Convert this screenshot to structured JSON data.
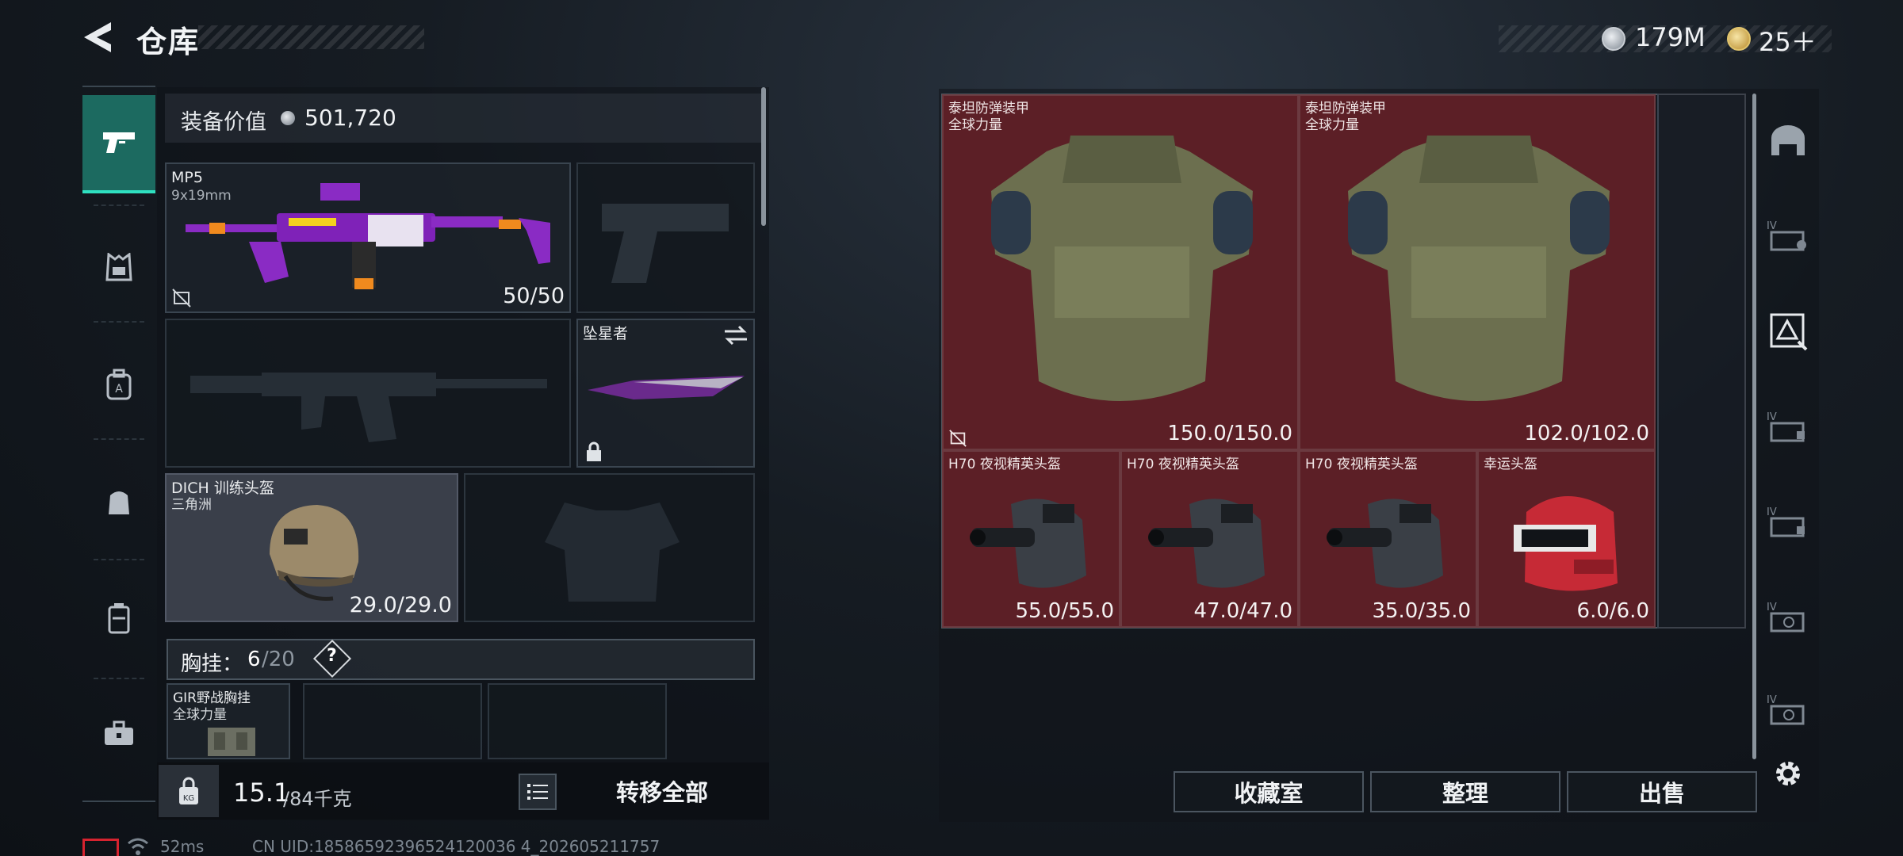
{
  "header": {
    "title": "仓库",
    "currency": [
      {
        "icon": "silver-coin-icon",
        "value": "179M"
      },
      {
        "icon": "gold-token-icon",
        "value": "25＋"
      }
    ]
  },
  "loadout": {
    "value_label": "装备价值",
    "value": "501,720",
    "primary": {
      "name": "MP5",
      "caliber": "9x19mm",
      "ammo": "50/50"
    },
    "melee": {
      "name": "坠星者"
    },
    "helmet": {
      "name": "DICH 训练头盔",
      "tag": "三角洲",
      "durability": "29.0/29.0"
    },
    "chest_rig": {
      "label": "胸挂：",
      "count": "6",
      "capacity": "/20",
      "help": "?"
    },
    "rig_item": {
      "name": "GIR野战胸挂",
      "tag": "全球力量"
    }
  },
  "footer": {
    "weight": "15.1",
    "weight_max": "/84千克",
    "transfer_all": "转移全部"
  },
  "storage": {
    "armor": [
      {
        "name": "泰坦防弹装甲",
        "tag": "全球力量",
        "durability": "150.0/150.0"
      },
      {
        "name": "泰坦防弹装甲",
        "tag": "全球力量",
        "durability": "102.0/102.0"
      }
    ],
    "helmets": [
      {
        "name": "H70 夜视精英头盔",
        "durability": "55.0/55.0"
      },
      {
        "name": "H70 夜视精英头盔",
        "durability": "47.0/47.0"
      },
      {
        "name": "H70 夜视精英头盔",
        "durability": "35.0/35.0"
      },
      {
        "name": "幸运头盔",
        "durability": "6.0/6.0"
      }
    ]
  },
  "actions": {
    "collection": "收藏室",
    "organize": "整理",
    "sell": "出售"
  },
  "status": {
    "ping": "52ms",
    "uid": "CN UID:18586592396524120036 4_202605211757"
  }
}
